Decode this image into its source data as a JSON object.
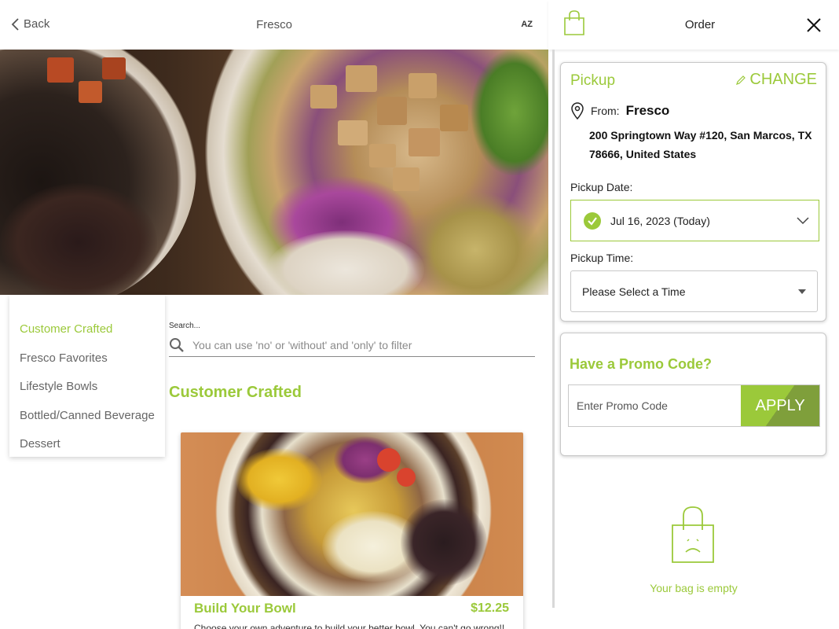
{
  "header": {
    "back_label": "Back",
    "store_title": "Fresco",
    "sort_label": "AZ"
  },
  "categories": [
    {
      "label": "Customer Crafted",
      "active": true
    },
    {
      "label": "Fresco Favorites",
      "active": false
    },
    {
      "label": "Lifestyle Bowls",
      "active": false
    },
    {
      "label": "Bottled/Canned Beverage",
      "active": false
    },
    {
      "label": "Dessert",
      "active": false
    }
  ],
  "search": {
    "label": "Search...",
    "placeholder": "You can use 'no' or 'without' and 'only' to filter",
    "value": ""
  },
  "menu": {
    "section_title": "Customer Crafted",
    "items": [
      {
        "name": "Build Your Bowl",
        "price": "$12.25",
        "description": "Choose your own adventure to build your better bowl. You can't go wrong!!"
      }
    ]
  },
  "order": {
    "title": "Order",
    "pickup": {
      "title": "Pickup",
      "change_label": "CHANGE",
      "from_label": "From:",
      "store_name": "Fresco",
      "address": "200 Springtown Way #120, San Marcos, TX 78666, United States",
      "date_label": "Pickup Date:",
      "date_value": "Jul 16, 2023 (Today)",
      "time_label": "Pickup Time:",
      "time_value": "Please Select a Time"
    },
    "promo": {
      "title": "Have a Promo Code?",
      "placeholder": "Enter Promo Code",
      "apply_label": "APPLY"
    },
    "empty_bag_text": "Your bag is empty"
  },
  "colors": {
    "accent": "#9bc93a",
    "accent_dark": "#7f9f3b",
    "text": "#333333"
  },
  "icons": {
    "back": "chevron-left-icon",
    "bag": "shopping-bag-icon",
    "close": "close-icon",
    "search": "search-icon",
    "location": "map-pin-icon",
    "edit": "pencil-icon",
    "check": "check-circle-icon",
    "dropdown": "chevron-down-icon",
    "empty_bag": "sad-bag-icon"
  }
}
